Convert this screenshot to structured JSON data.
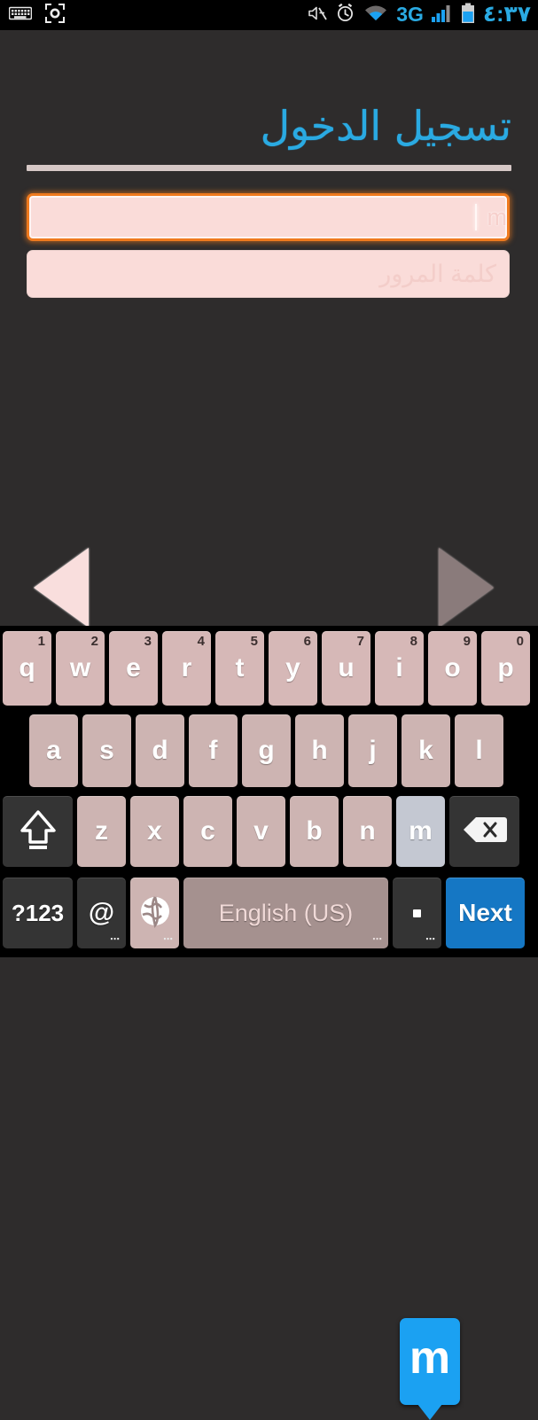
{
  "statusbar": {
    "left_icons": [
      "keyboard-icon",
      "screenshot-capture-icon"
    ],
    "right_icons": [
      "mute-icon",
      "alarm-icon",
      "wifi-icon",
      "signal-icon",
      "battery-icon"
    ],
    "network": "3G",
    "time": "٤:٣٧",
    "accent_color": "#2aaae2",
    "background": "#000000"
  },
  "screen": {
    "background": "#2e2c2c",
    "title": "تسجيل الدخول",
    "title_color": "#2aaae2"
  },
  "form": {
    "username": {
      "value": "m",
      "placeholder": "",
      "focused": true,
      "fill_color": "#fadcd9",
      "focus_border_color": "#ef7a1e"
    },
    "password": {
      "value": "",
      "placeholder": "كلمة المرور",
      "focused": false,
      "fill_color": "#fadcd9"
    }
  },
  "nav": {
    "prev_label": "previous-arrow",
    "next_label": "next-arrow",
    "prev_color": "#f9dedd",
    "next_color": "#8a7b7b"
  },
  "keyboard": {
    "popup_key": "m",
    "popup_color": "#1ba1f2",
    "pressed_key": "m",
    "row1": [
      {
        "key": "q",
        "num": "1"
      },
      {
        "key": "w",
        "num": "2"
      },
      {
        "key": "e",
        "num": "3"
      },
      {
        "key": "r",
        "num": "4"
      },
      {
        "key": "t",
        "num": "5"
      },
      {
        "key": "y",
        "num": "6"
      },
      {
        "key": "u",
        "num": "7"
      },
      {
        "key": "i",
        "num": "8"
      },
      {
        "key": "o",
        "num": "9"
      },
      {
        "key": "p",
        "num": "0"
      }
    ],
    "row2": [
      {
        "key": "a"
      },
      {
        "key": "s"
      },
      {
        "key": "d"
      },
      {
        "key": "f"
      },
      {
        "key": "g"
      },
      {
        "key": "h"
      },
      {
        "key": "j"
      },
      {
        "key": "k"
      },
      {
        "key": "l"
      }
    ],
    "row3": [
      {
        "key": "z"
      },
      {
        "key": "x"
      },
      {
        "key": "c"
      },
      {
        "key": "v"
      },
      {
        "key": "b"
      },
      {
        "key": "n"
      },
      {
        "key": "m"
      }
    ],
    "shift_label": "shift-icon",
    "backspace_label": "backspace-icon",
    "symbols_label": "?123",
    "at_label": "@",
    "globe_label": "globe-icon",
    "space_label": "English (US)",
    "period_label": ".",
    "enter_label": "Next",
    "enter_color": "#1577c4",
    "more_dots": "⋯"
  }
}
